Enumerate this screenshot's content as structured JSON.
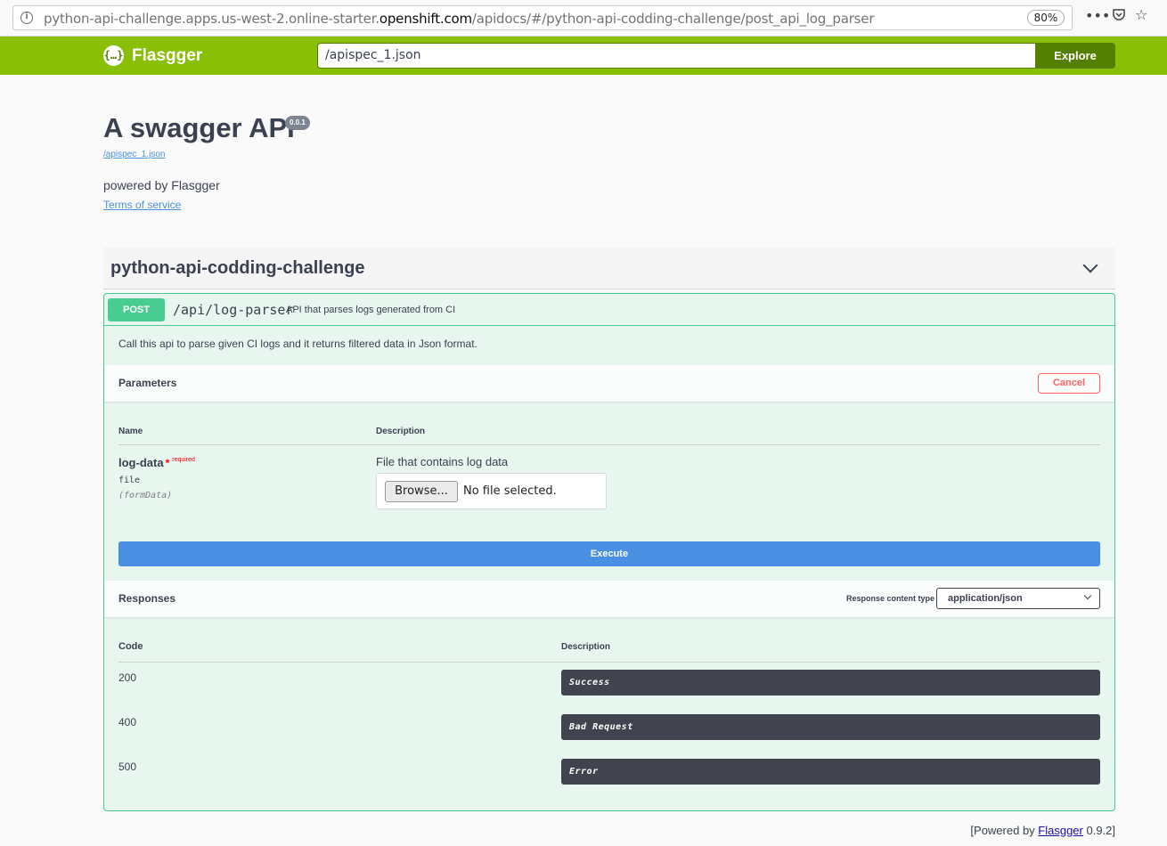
{
  "browser": {
    "url_prefix": "python-api-challenge.apps.us-west-2.online-starter.",
    "url_host": "openshift.com",
    "url_path": "/apidocs/#/python-api-codding-challenge/post_api_log_parser",
    "zoom": "80%"
  },
  "topbar": {
    "logo_text": "Flasgger",
    "spec_url": "/apispec_1.json",
    "explore_label": "Explore"
  },
  "info": {
    "title": "A swagger API",
    "version": "0.0.1",
    "spec_link": "/apispec_1.json",
    "description": "powered by Flasgger",
    "terms": "Terms of service"
  },
  "tag": {
    "name": "python-api-codding-challenge"
  },
  "operation": {
    "method": "POST",
    "path": "/api/log-parser",
    "summary": "API that parses logs generated from CI",
    "description": "Call this api to parse given CI logs and it returns filtered data in Json format.",
    "parameters_title": "Parameters",
    "cancel_label": "Cancel",
    "col_name": "Name",
    "col_description": "Description",
    "param": {
      "name": "log-data",
      "required_star": "*",
      "required_text": "required",
      "type": "file",
      "in": "(formData)",
      "description": "File that contains log data",
      "browse_label": "Browse...",
      "no_file": "No file selected."
    },
    "execute_label": "Execute",
    "responses_title": "Responses",
    "content_type_label": "Response content type",
    "content_type_value": "application/json",
    "col_code": "Code",
    "col_resp_description": "Description",
    "responses": [
      {
        "code": "200",
        "description": "Success"
      },
      {
        "code": "400",
        "description": "Bad Request"
      },
      {
        "code": "500",
        "description": "Error"
      }
    ]
  },
  "footer": {
    "prefix": "[Powered by ",
    "link": "Flasgger",
    "suffix": " 0.9.2]"
  },
  "colors": {
    "topbar": "#89bf04",
    "post": "#49cc90",
    "execute": "#4990e2",
    "cancel": "#ff6060"
  }
}
